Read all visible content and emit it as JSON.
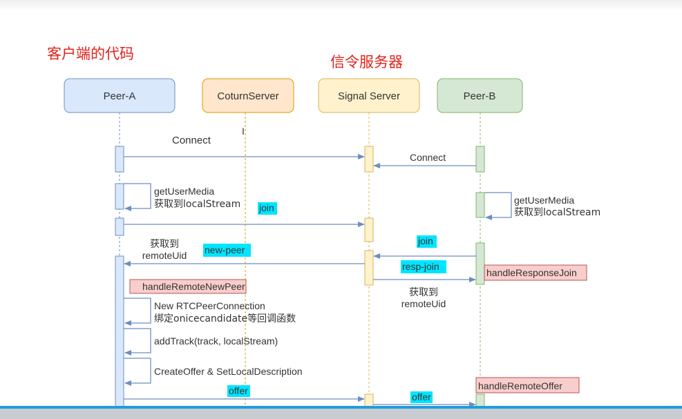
{
  "colors": {
    "peer_a_fill": "#dae8fc",
    "peer_a_stroke": "#6c8ebf",
    "coturn_fill": "#ffe6cc",
    "coturn_stroke": "#d79b00",
    "signal_fill": "#fff2cc",
    "signal_stroke": "#d6b656",
    "peer_b_fill": "#d5e8d4",
    "peer_b_stroke": "#82b366",
    "arrow": "#6c8ebf",
    "highlight": "#00e5ff",
    "note_fill": "#f8cecc",
    "note_stroke": "#b85450",
    "heading": "#e0231a"
  },
  "headings": {
    "client_code": "客户端的代码",
    "signal_server": "信令服务器"
  },
  "participants": {
    "peer_a": "Peer-A",
    "coturn": "CoturnServer",
    "signal": "Signal Server",
    "peer_b": "Peer-B"
  },
  "messages": {
    "connect_a": "Connect",
    "connect_b": "Connect",
    "get_user_media_a_1": "getUserMedia",
    "get_user_media_a_2": "获取到localStream",
    "join_a": "join",
    "get_user_media_b_1": "getUserMedia",
    "get_user_media_b_2": "获取到localStream",
    "join_b": "join",
    "get_remote_a_1": "获取到",
    "get_remote_a_2": "remoteUid",
    "new_peer": "new-peer",
    "resp_join": "resp-join",
    "get_remote_b_1": "获取到",
    "get_remote_b_2": "remoteUid",
    "new_rtc_1": "New RTCPeerConnection",
    "new_rtc_2": "绑定onicecandidate等回调函数",
    "add_track": "addTrack(track, localStream)",
    "create_offer": "CreateOffer &  SetLocalDescription",
    "offer_a": "offer",
    "offer_b": "offer"
  },
  "notes": {
    "handle_remote_new_peer": "handleRemoteNewPeer",
    "handle_response_join": "handleResponseJoin",
    "handle_remote_offer": "handleRemoteOffer"
  }
}
